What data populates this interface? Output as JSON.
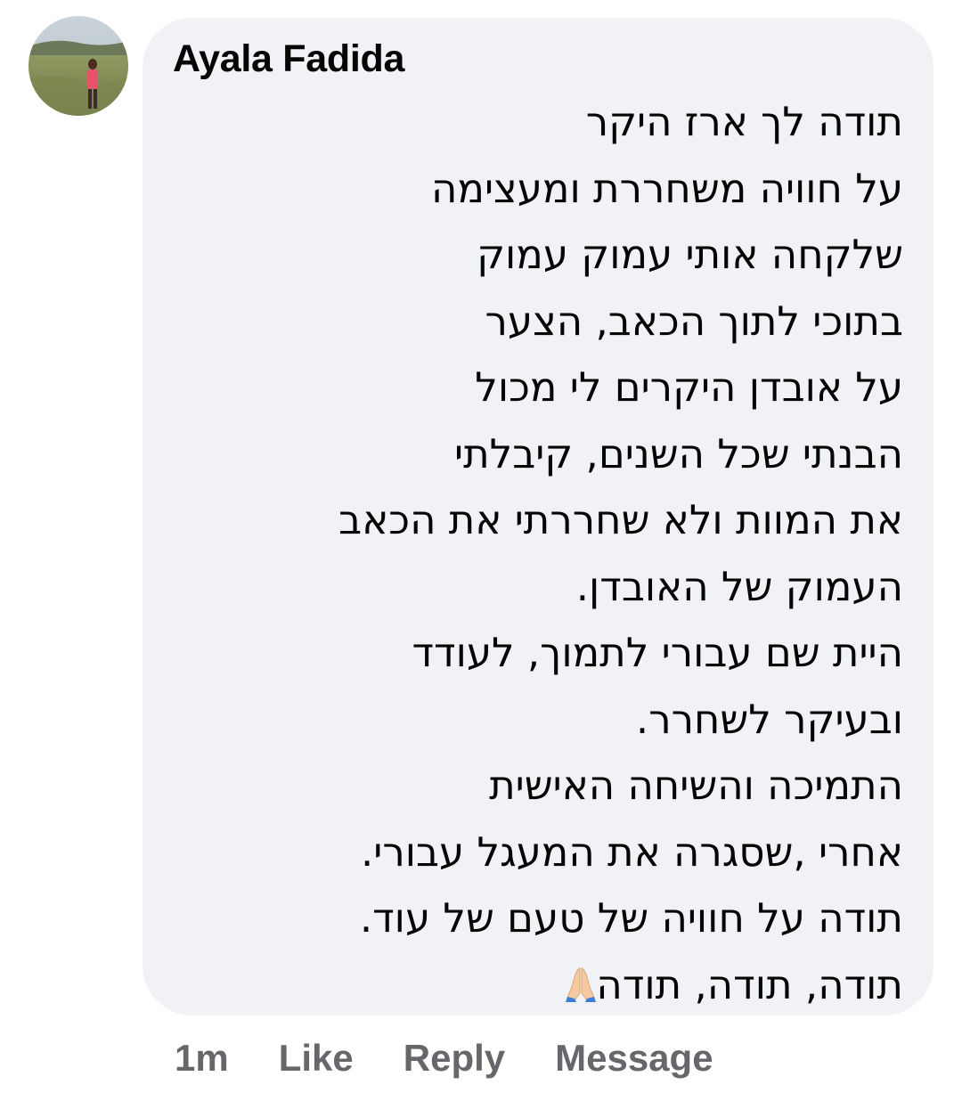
{
  "comment": {
    "author": "Ayala Fadida",
    "avatar_icon": "user-photo-avatar",
    "lines": [
      "תודה לך ארז היקר",
      "על חוויה משחררת ומעצימה",
      "שלקחה אותי עמוק עמוק",
      "בתוכי לתוך הכאב, הצער",
      "על אובדן היקרים לי מכול",
      "הבנתי שכל השנים, קיבלתי",
      "את המוות ולא שחררתי את הכאב",
      "העמוק של האובדן.",
      "היית שם עבורי לתמוך, לעודד",
      "ובעיקר לשחרר.",
      "התמיכה והשיחה האישית",
      "אחרי ,שסגרה את המעגל עבורי.",
      "תודה על חוויה של טעם של עוד.",
      "תודה, תודה, תודה"
    ],
    "emoji_icon": "folded-hands-emoji",
    "bubble_color": "#f0f2f5",
    "text_color": "#050505",
    "meta_color": "#65676b"
  },
  "actions": {
    "timestamp": "1m",
    "like": "Like",
    "reply": "Reply",
    "message": "Message"
  }
}
